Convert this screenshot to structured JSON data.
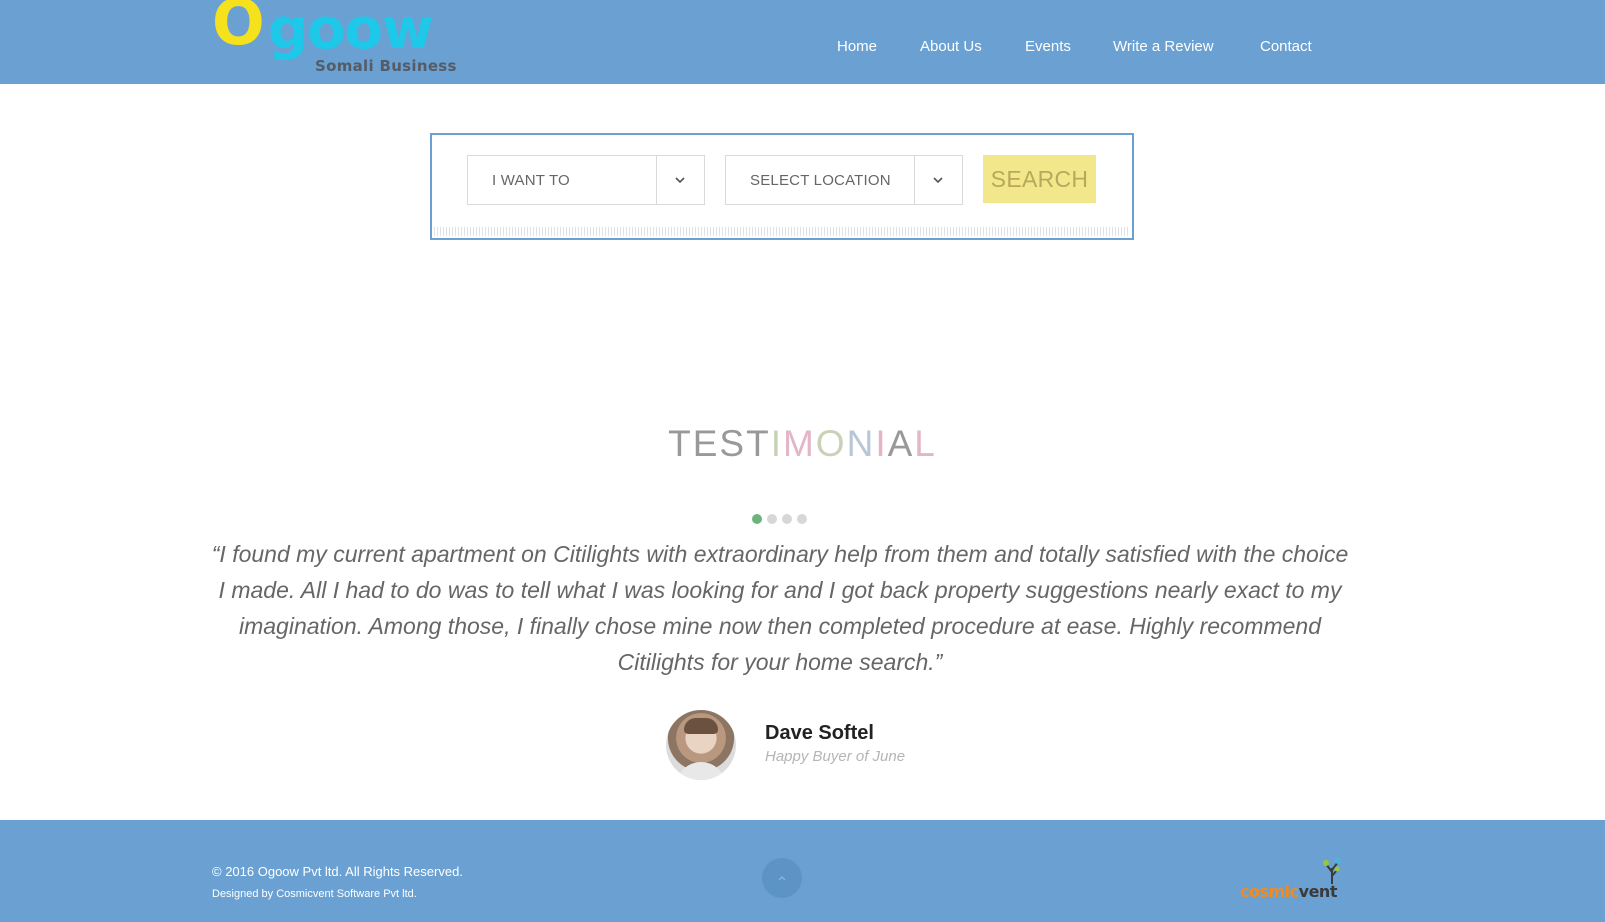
{
  "brand": {
    "logo_initial": "O",
    "logo_rest": "goow",
    "logo_subtitle": "Somali Business"
  },
  "nav": {
    "items": [
      {
        "label": "Home"
      },
      {
        "label": "About Us"
      },
      {
        "label": "Events"
      },
      {
        "label": "Write a Review"
      },
      {
        "label": "Contact"
      }
    ]
  },
  "search": {
    "category_select": "I WANT TO",
    "location_select": "SELECT LOCATION",
    "button_label": "SEARCH"
  },
  "testimonial": {
    "title_parts": [
      "TEST",
      "I",
      "M",
      "O",
      "N",
      "I",
      "A",
      "L"
    ],
    "slide_count": 4,
    "active_slide": 1,
    "quote": "“I found my current apartment on Citilights with extraordinary help from them and totally satisfied with the choice I made. All I had to do was to tell what I was looking for and I got back property suggestions nearly exact to my imagination. Among those, I finally chose mine now then completed procedure at ease. Highly recommend Citilights for your home search.”",
    "author_name": "Dave Softel",
    "author_role": "Happy Buyer of June"
  },
  "footer": {
    "copyright": "© 2016 Ogoow Pvt ltd. All Rights Reserved.",
    "designed_by": "Designed by Cosmicvent Software Pvt ltd.",
    "partner_logo_part1": "cosmic",
    "partner_logo_part2": "vent",
    "back_to_top_icon": "chevron-up-icon"
  },
  "colors": {
    "header_bg": "#6aa1d2",
    "logo_yellow": "#f6e21c",
    "logo_cyan": "#1ec8e8",
    "search_button": "#f2e78a",
    "active_dot": "#6cb37f",
    "footer_bg": "#6aa1d2"
  }
}
